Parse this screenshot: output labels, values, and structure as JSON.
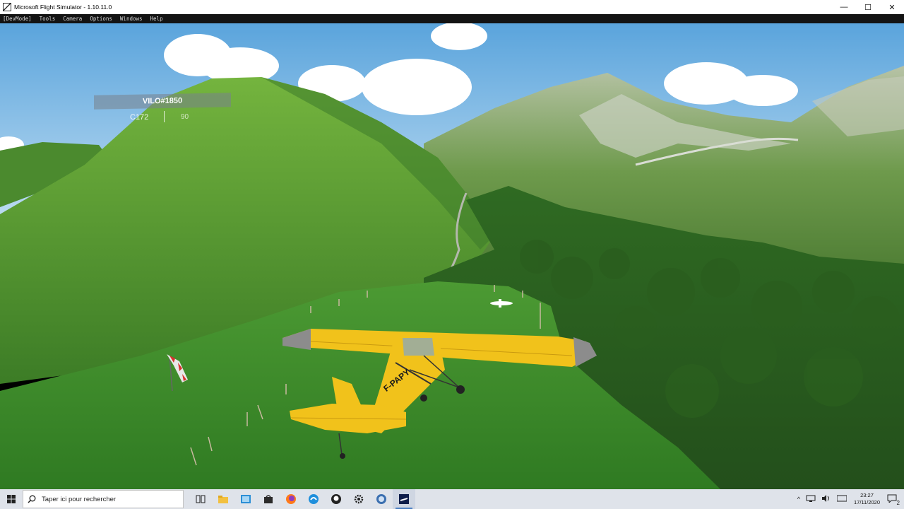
{
  "window": {
    "title": "Microsoft Flight Simulator - 1.10.11.0",
    "minimize_glyph": "—",
    "maximize_glyph": "☐",
    "close_glyph": "✕"
  },
  "dev_menu": {
    "items": [
      "[DevMode]",
      "Tools",
      "Camera",
      "Options",
      "Windows",
      "Help"
    ]
  },
  "scene": {
    "player_tag": "VILO#1850",
    "aircraft_type": "C172",
    "distance_partial": "90",
    "aircraft_registration": "F-PAPY"
  },
  "taskbar": {
    "search_placeholder": "Taper ici pour rechercher",
    "icons": [
      "task-view-icon",
      "file-explorer-icon",
      "photos-icon",
      "store-icon",
      "firefox-icon",
      "edge-icon",
      "github-icon",
      "settings-icon",
      "wifi-app-icon",
      "flight-simulator-icon"
    ],
    "tray": {
      "chevron": "^",
      "time": "23:27",
      "date": "17/11/2020",
      "notifications_count": "2"
    }
  },
  "colors": {
    "sky_top": "#5aa4dc",
    "sky_bottom": "#cde6f7",
    "grass": "#3f8a2a",
    "plane_yellow": "#f1c21b"
  }
}
